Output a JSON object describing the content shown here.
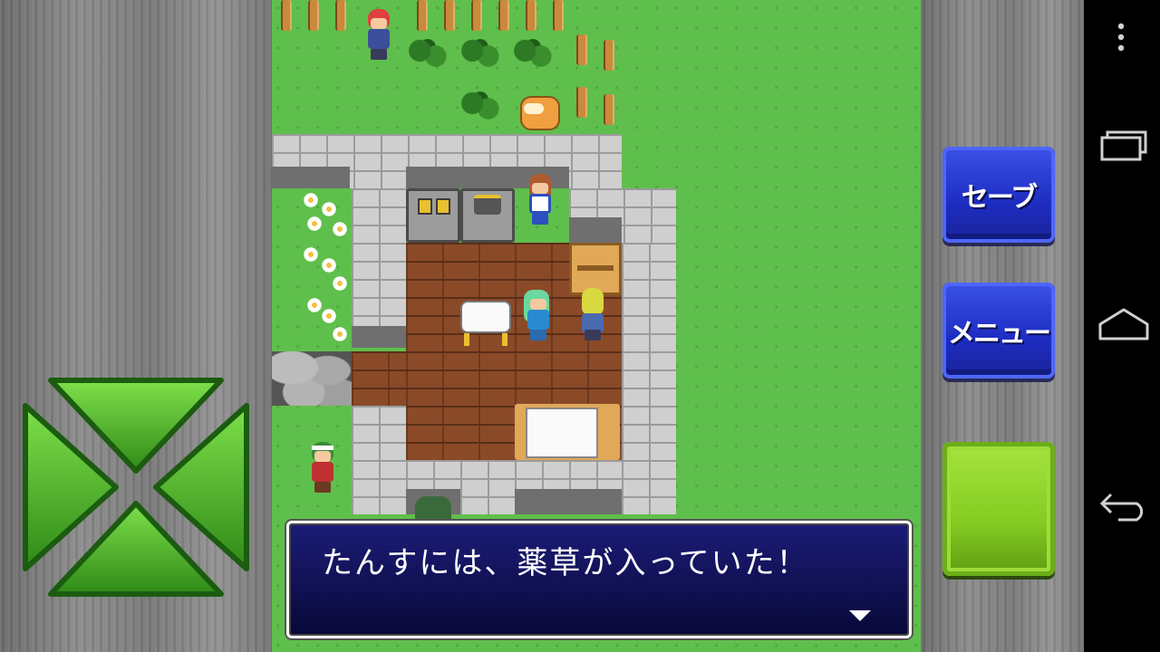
{
  "dialog": {
    "message": "たんすには、薬草が入っていた！"
  },
  "buttons": {
    "save_label": "セーブ",
    "menu_label": "メニュー"
  },
  "icons": {
    "overflow": "more-vert-icon",
    "recents": "recents-icon",
    "home": "home-icon",
    "back": "back-icon"
  },
  "colors": {
    "save_button": "#2233cc",
    "menu_button": "#2233cc",
    "action_button": "#88cc22",
    "dpad": "#44aa22",
    "dialog_bg": "#10105a"
  }
}
